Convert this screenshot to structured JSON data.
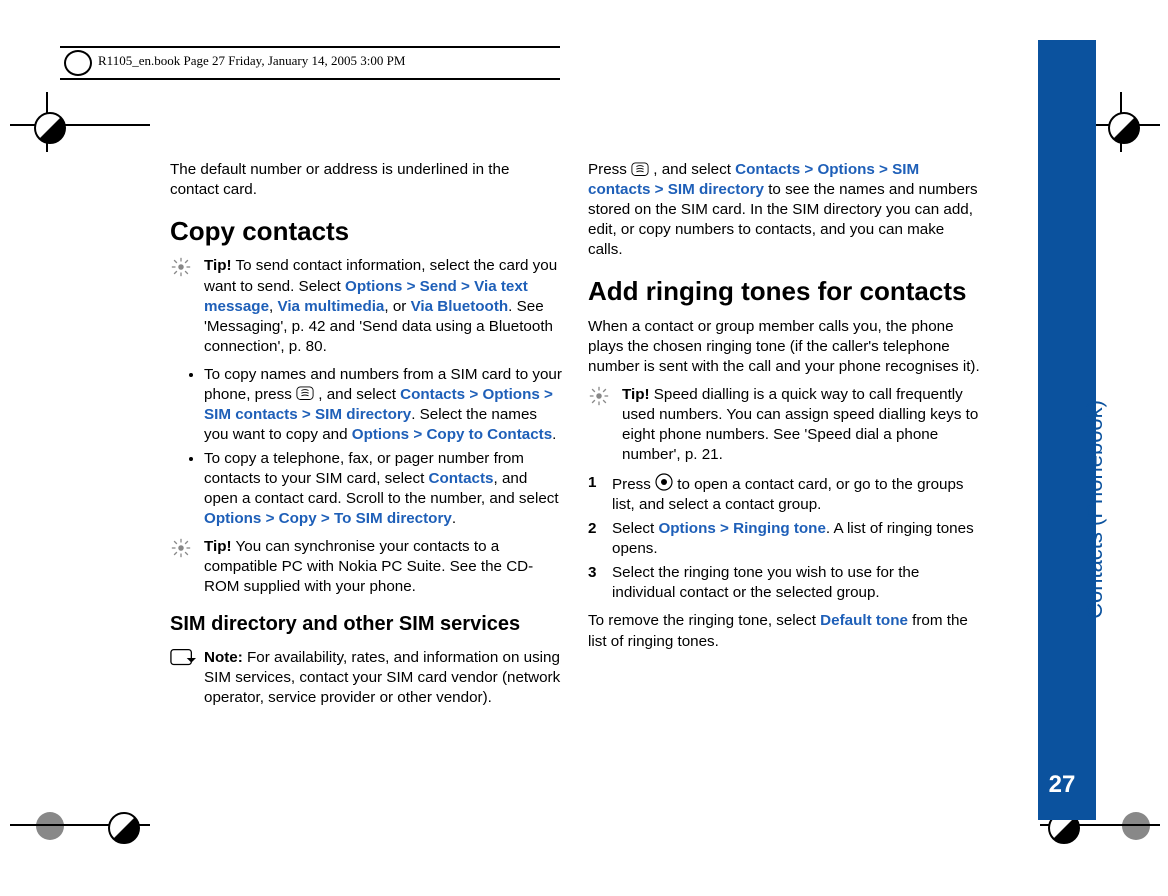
{
  "header": {
    "bookline": "R1105_en.book  Page 27  Friday, January 14, 2005  3:00 PM"
  },
  "sidebar": {
    "title": "Contacts (Phonebook)",
    "page_number": "27"
  },
  "col1": {
    "intro": "The default number or address is underlined in the contact card.",
    "h2_copy": "Copy contacts",
    "tip1_label": "Tip!",
    "tip1_text_a": " To send contact information, select the card you want to send. Select ",
    "tip1_link1": "Options > Send > Via text message",
    "tip1_sep1": ", ",
    "tip1_link2": "Via multimedia",
    "tip1_sep2": ", or ",
    "tip1_link3": "Via Bluetooth",
    "tip1_text_b": ". See 'Messaging', p. 42 and 'Send data using a Bluetooth connection', p. 80.",
    "bullet1_a": "To copy names and numbers from a SIM card to your phone, press ",
    "bullet1_b": " , and select ",
    "bullet1_link1": "Contacts > Options > SIM contacts > SIM directory",
    "bullet1_c": ". Select the names you want to copy and ",
    "bullet1_link2": "Options > Copy to Contacts",
    "bullet1_d": ".",
    "bullet2_a": "To copy a telephone, fax, or pager number from contacts to your SIM card, select ",
    "bullet2_link1": "Contacts",
    "bullet2_b": ", and open a contact card. Scroll to the number, and select ",
    "bullet2_link2": "Options > Copy > To SIM directory",
    "bullet2_c": ".",
    "tip2_label": "Tip!",
    "tip2_text": " You can synchronise your contacts to a compatible PC with Nokia PC Suite. See the CD-ROM supplied with your phone.",
    "h3_sim": "SIM directory and other SIM services",
    "note_label": "Note:",
    "note_text": " For availability, rates, and information on using SIM services, contact your SIM card vendor (network operator, service provider or other vendor)."
  },
  "col2": {
    "para1_a": "Press ",
    "para1_b": " , and select ",
    "para1_link1": "Contacts > Options >  SIM contacts > SIM directory",
    "para1_c": " to see the names and numbers stored on the SIM card. In the SIM directory you can add, edit, or copy numbers to contacts, and you can make calls.",
    "h2_ring": "Add ringing tones for contacts",
    "para2": "When a contact or group member calls you, the phone plays the chosen ringing tone (if the caller's telephone number is sent with the call and your phone recognises it).",
    "tip_label": "Tip!",
    "tip_text": " Speed dialling is a quick way to call frequently used numbers. You can assign speed dialling keys to eight phone numbers. See 'Speed dial a phone number', p. 21.",
    "step1_num": "1",
    "step1_a": "Press ",
    "step1_b": " to open a contact card, or go to the groups list, and select a contact group.",
    "step2_num": "2",
    "step2_a": "Select ",
    "step2_link": "Options > Ringing tone",
    "step2_b": ". A list of ringing tones opens.",
    "step3_num": "3",
    "step3_a": "Select the ringing tone you wish to use for the individual contact or the selected group.",
    "para3_a": "To remove the ringing tone, select ",
    "para3_link": "Default tone",
    "para3_b": " from the list of ringing tones."
  }
}
